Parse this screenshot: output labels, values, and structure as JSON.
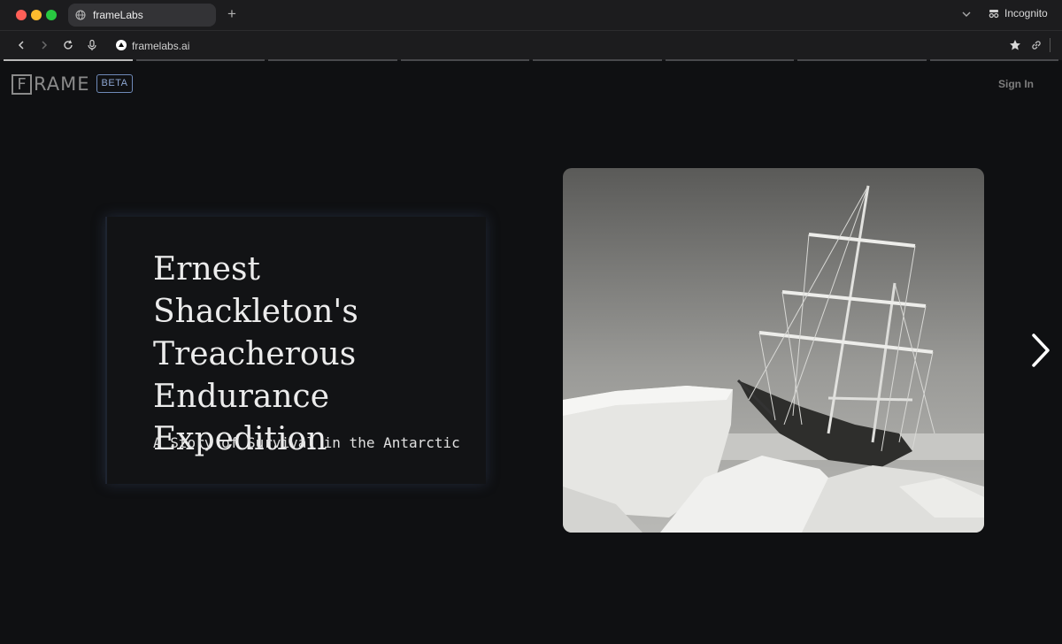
{
  "browser": {
    "tab_title": "frameLabs",
    "new_tab_glyph": "+",
    "incognito_label": "Incognito",
    "url": "framelabs.ai",
    "story_segments": 8,
    "active_segment": 1
  },
  "header": {
    "logo_first_letter": "F",
    "logo_rest": "RAME",
    "beta_badge": "BETA",
    "sign_in": "Sign In"
  },
  "story": {
    "title": "Ernest Shackleton's Treacherous Endurance Expedition",
    "subtitle": "A Story of Survival in the Antarctic",
    "image_alt": "Black and white photo of a ship trapped in Antarctic ice",
    "next_icon": "chevron-right-icon"
  },
  "colors": {
    "background": "#0f1012",
    "beta_accent": "#6f8ab8",
    "card_glow": "#465a82"
  }
}
